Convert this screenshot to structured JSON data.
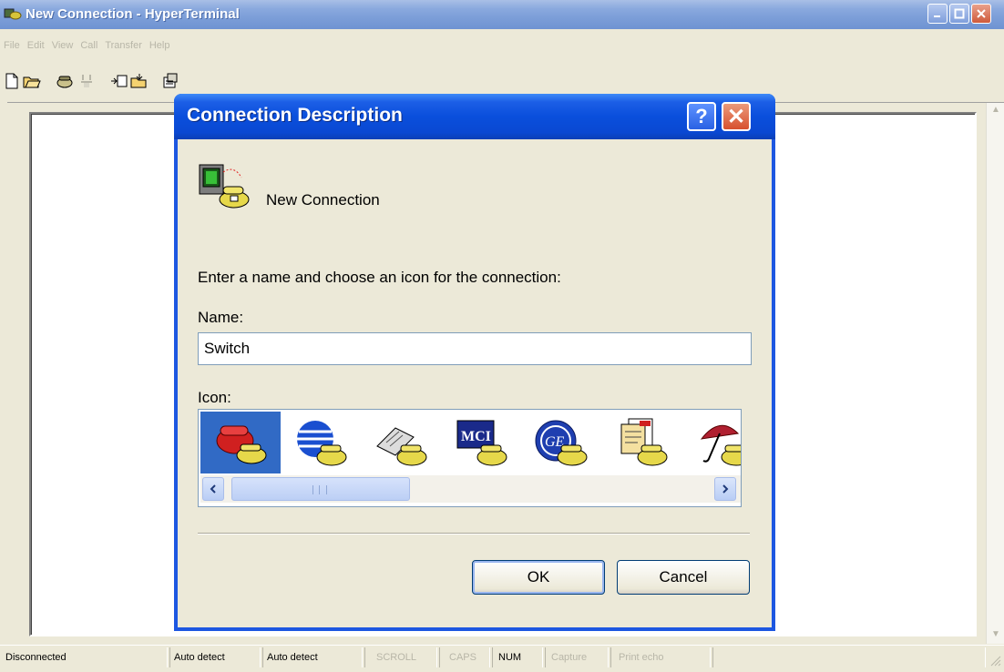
{
  "main_window": {
    "title": "New Connection - HyperTerminal",
    "menu": [
      "File",
      "Edit",
      "View",
      "Call",
      "Transfer",
      "Help"
    ],
    "toolbar_icons": [
      "new-document-icon",
      "open-folder-icon",
      "call-icon",
      "disconnect-icon",
      "send-icon",
      "receive-icon",
      "properties-icon"
    ]
  },
  "dialog": {
    "title": "Connection Description",
    "help_symbol": "?",
    "close_symbol": "✕",
    "connection_name_heading": "New Connection",
    "prompt": "Enter a name and choose an icon for the connection:",
    "name_label": "Name:",
    "name_value": "Switch",
    "icon_label": "Icon:",
    "icons": [
      "red-telephone-icon",
      "blue-globe-phone-icon",
      "fax-phone-icon",
      "mci-phone-icon",
      "ge-globe-phone-icon",
      "documents-phone-icon",
      "umbrella-phone-icon"
    ],
    "selected_icon_index": 0,
    "ok_label": "OK",
    "cancel_label": "Cancel"
  },
  "statusbar": {
    "connection": "Disconnected",
    "detect1": "Auto detect",
    "detect2": "Auto detect",
    "scroll": "SCROLL",
    "caps": "CAPS",
    "num": "NUM",
    "capture": "Capture",
    "print_echo": "Print echo"
  },
  "colors": {
    "dialog_title_blue": "#0a4fdc",
    "selection_blue": "#316ac5",
    "face": "#ece9d8"
  }
}
